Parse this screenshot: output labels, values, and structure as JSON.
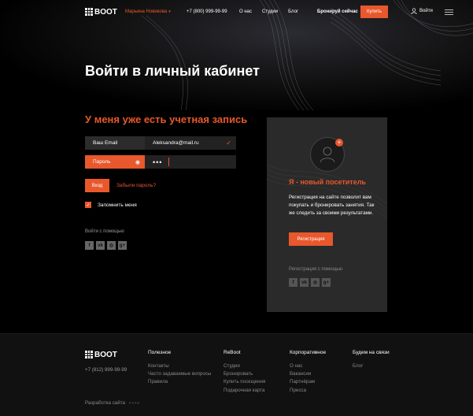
{
  "header": {
    "logo_text": "BOOT",
    "city": "Марьина Новикова",
    "phone": "+7 (800) 999-99-99",
    "nav": [
      "О нас",
      "Студии",
      "Блог"
    ],
    "book_label": "Бронируй сейчас",
    "buy_label": "Купить",
    "login_label": "Войти"
  },
  "page": {
    "title": "Войти в личный кабинет"
  },
  "login_form": {
    "section_title": "У меня уже есть учетная запись",
    "email_label": "Ваш Email",
    "email_value": "Aleksandra@mail.ru",
    "password_label": "Пароль",
    "password_value": "•••",
    "submit_label": "Вход",
    "forgot_label": "Забыли пароль?",
    "remember_label": "Запомнить меня",
    "remember_checked": true,
    "social_label": "Войти с помощью",
    "socials": [
      "f",
      "vk",
      "ig",
      "g+"
    ]
  },
  "register_panel": {
    "title": "Я - новый посетитель",
    "text": "Регистрация на сайте позволит вам покупать и бронировать занятия. Так же следить за своими результатами.",
    "button_label": "Регистрация",
    "social_label": "Регистрация с помощью"
  },
  "footer": {
    "logo_text": "BOOT",
    "phone": "+7 (812) 999-99-99",
    "columns": [
      {
        "title": "Полезное",
        "items": [
          "Контакты",
          "Часто задаваемые вопросы",
          "Правила"
        ]
      },
      {
        "title": "ReBoot",
        "items": [
          "Студии",
          "Бронировать",
          "Купить посещения",
          "Подарочная карта"
        ]
      },
      {
        "title": "Корпоративное",
        "items": [
          "О нас",
          "Вакансии",
          "Партнёрам",
          "Пресса"
        ]
      },
      {
        "title": "Будем на связи",
        "items": [
          "Блог"
        ]
      }
    ],
    "developer_label": "Разработка сайта",
    "developer_tag": "ᴘᴀᴘᴇ"
  },
  "colors": {
    "accent": "#e8582c",
    "background": "#000000",
    "panel": "#2a2a2a",
    "footer": "#111111"
  }
}
